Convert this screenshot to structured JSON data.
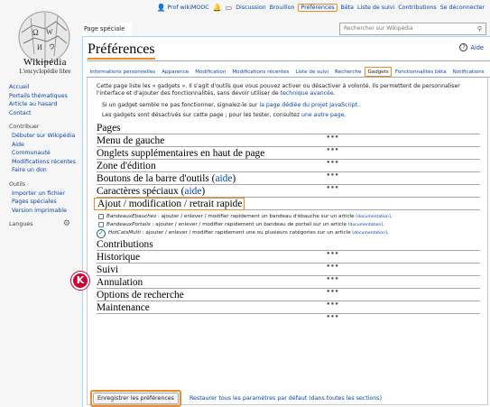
{
  "personal": {
    "user": "Prof wikiMOOC",
    "items": [
      "Discussion",
      "Brouillon",
      "Préférences",
      "Bêta",
      "Liste de suivi",
      "Contributions",
      "Se déconnecter"
    ]
  },
  "logo": {
    "wordmark": "Wikipédia",
    "tagline": "L'encyclopédie libre"
  },
  "sidebar": {
    "nav": [
      "Accueil",
      "Portails thématiques",
      "Article au hasard",
      "Contact"
    ],
    "contribute_heading": "Contribuer",
    "contribute": [
      "Débuter sur Wikipédia",
      "Aide",
      "Communauté",
      "Modifications récentes",
      "Faire un don"
    ],
    "tools_heading": "Outils",
    "tools": [
      "Importer un fichier",
      "Pages spéciales",
      "Version imprimable"
    ],
    "languages_heading": "Langues"
  },
  "tab": {
    "page": "Page spéciale"
  },
  "search": {
    "placeholder": "Rechercher sur Wikipédia"
  },
  "page": {
    "title": "Préférences",
    "help": "Aide"
  },
  "tabs": [
    "Informations personnelles",
    "Apparence",
    "Modification",
    "Modifications récentes",
    "Liste de suivi",
    "Recherche",
    "Gadgets",
    "Fonctionnalités bêta",
    "Notifications"
  ],
  "intro": {
    "line1": "Cette page liste les « gadgets ». Il s'agit d'outils que vous pouvez activer ou désactiver à volonté. Ils permettent de personnaliser l'interface et d'ajouter des fonctionnalités, sans devoir utiliser de ",
    "link1": "technique avancée",
    "line1_end": ".",
    "note1_pre": "Si un gadget semble ne pas fonctionner, signalez-le sur ",
    "note1_link": "la page dédiée du projet JavaScript",
    "note1_end": ".",
    "note2_pre": "Les gadgets sont désactivés sur cette page ; pour les tester, consultez ",
    "note2_link": "une autre page",
    "note2_end": "."
  },
  "sections_a": [
    {
      "label": "Pages",
      "dots": ""
    },
    {
      "label": "Menu de gauche",
      "dots": "●●●"
    },
    {
      "label": "Onglets supplémentaires en haut de page",
      "dots": "●●●"
    },
    {
      "label": "Zone d'édition",
      "dots": "●●●"
    },
    {
      "label": "Boutons de la barre d'outils (",
      "link": "aide",
      "end": ")",
      "dots": "●●●"
    },
    {
      "label": "Caractères spéciaux (",
      "link": "aide",
      "end": ")",
      "dots": "●●●"
    }
  ],
  "highlight_section": "Ajout / modification / retrait rapide",
  "gadgets": [
    {
      "name": "BandeauxEbauches",
      "desc": " : ajouter / enlever / modifier rapidement un bandeau d'ébauche sur un article ",
      "doc": "[documentation]"
    },
    {
      "name": "BandeauxPortails",
      "desc": " : ajouter / enlever / modifier rapidement un bandeau de portail sur un article ",
      "doc": "[documentation]"
    },
    {
      "name": "HotCatsMulti",
      "desc": " : ajouter / enlever / modifier rapidement une ou plusieurs catégories sur un article ",
      "doc": "[documentation]"
    }
  ],
  "sections_b": [
    {
      "label": "Contributions",
      "dots": ""
    },
    {
      "label": "Historique",
      "dots": "●●●"
    },
    {
      "label": "Suivi",
      "dots": "●●●"
    },
    {
      "label": "Annulation",
      "dots": "●●●"
    },
    {
      "label": "Options de recherche",
      "dots": "●●●"
    },
    {
      "label": "Maintenance",
      "dots": "●●●"
    }
  ],
  "last_dots": "●●●",
  "actions": {
    "save": "Enregistrer les préférences",
    "restore": "Restaurer tous les paramètres par défaut (dans toutes les sections)"
  },
  "badge": "K",
  "colors": {
    "highlight": "#f08a24",
    "link": "#0645ad",
    "badge": "#cc0033"
  }
}
